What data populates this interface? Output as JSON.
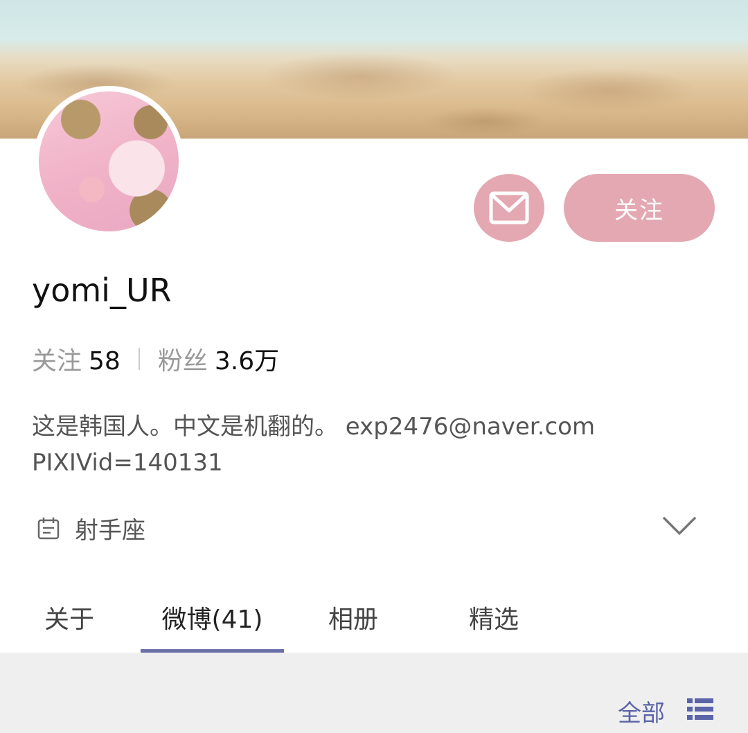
{
  "profile": {
    "username": "yomi_UR",
    "follow_button": "关注",
    "stats": {
      "following_label": "关注",
      "following_value": "58",
      "followers_label": "粉丝",
      "followers_value": "3.6万"
    },
    "bio_line1": "这是韩国人。中文是机翻的。 exp2476@naver.com",
    "bio_line2": "PIXIVid=140131",
    "zodiac": "射手座"
  },
  "tabs": [
    {
      "label": "关于"
    },
    {
      "label": "微博(41)",
      "active": true
    },
    {
      "label": "相册"
    },
    {
      "label": "精选"
    }
  ],
  "feed": {
    "filter_label": "全部"
  },
  "icons": {
    "message": "mail-icon",
    "zodiac": "calendar-icon",
    "expand": "chevron-down-icon",
    "list": "list-icon"
  },
  "colors": {
    "button_pink": "#e4a8b2",
    "accent": "#6b6fa8",
    "filter_blue": "#5b64a8"
  }
}
